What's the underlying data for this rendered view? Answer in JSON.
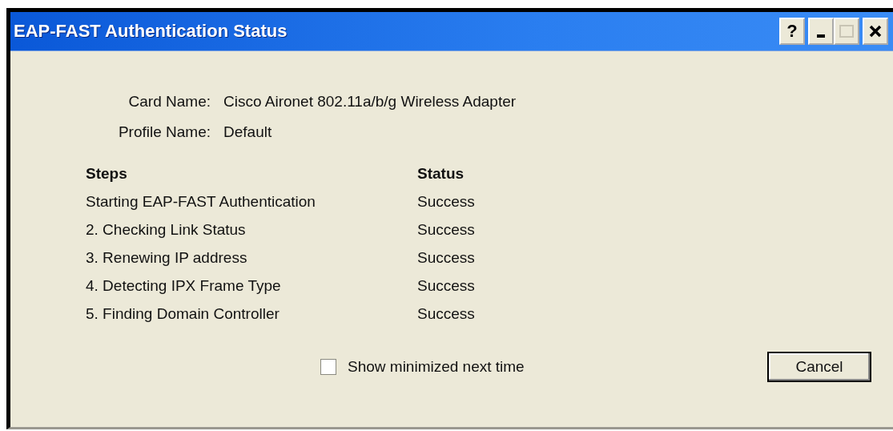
{
  "window": {
    "title": "EAP-FAST Authentication Status",
    "help_button": "?",
    "maximize_disabled": true
  },
  "info": [
    {
      "label": "Card Name:",
      "value": "Cisco Aironet 802.11a/b/g Wireless Adapter"
    },
    {
      "label": "Profile Name:",
      "value": "Default"
    }
  ],
  "table": {
    "columns": [
      "Steps",
      "Status"
    ],
    "rows": [
      {
        "step": "Starting EAP-FAST Authentication",
        "status": "Success"
      },
      {
        "step": "2. Checking Link Status",
        "status": "Success"
      },
      {
        "step": "3. Renewing IP address",
        "status": "Success"
      },
      {
        "step": "4. Detecting IPX Frame Type",
        "status": "Success"
      },
      {
        "step": "5. Finding Domain Controller",
        "status": "Success"
      }
    ]
  },
  "show_minimized": {
    "label": "Show minimized next time",
    "checked": false
  },
  "buttons": [
    "Cancel"
  ]
}
